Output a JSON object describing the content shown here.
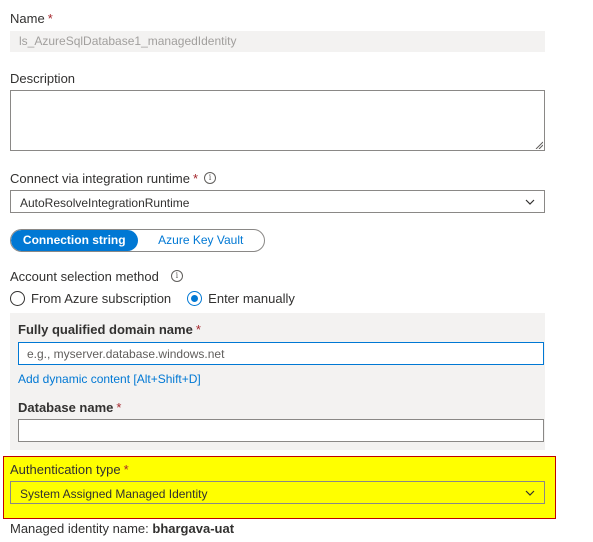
{
  "name_field": {
    "label": "Name",
    "required": "*",
    "value": "ls_AzureSqlDatabase1_managedIdentity"
  },
  "description_field": {
    "label": "Description",
    "value": ""
  },
  "integration_runtime": {
    "label": "Connect via integration runtime",
    "required": "*",
    "info": "i",
    "selected": "AutoResolveIntegrationRuntime"
  },
  "connection_toggle": {
    "option_1": "Connection string",
    "option_2": "Azure Key Vault",
    "active": "Connection string"
  },
  "account_selection": {
    "label": "Account selection method",
    "info": "i",
    "options": [
      "From Azure subscription",
      "Enter manually"
    ],
    "selected": "Enter manually"
  },
  "fqdn_field": {
    "label": "Fully qualified domain name",
    "required": "*",
    "placeholder": "e.g., myserver.database.windows.net"
  },
  "dynamic_content_link": "Add dynamic content [Alt+Shift+D]",
  "database_field": {
    "label": "Database name",
    "required": "*",
    "value": ""
  },
  "authentication": {
    "label": "Authentication type",
    "required": "*",
    "selected": "System Assigned Managed Identity"
  },
  "managed_identity": {
    "name_label": "Managed identity name:",
    "name_value": "bhargava-uat"
  },
  "colors": {
    "accent": "#0078d4",
    "required": "#a4262c",
    "highlight": "#ffff00",
    "highlight_border": "#c00000"
  },
  "icons": {
    "dropdown": "chevron-down-icon",
    "info": "info-icon",
    "resize": "resize-grip-icon"
  }
}
